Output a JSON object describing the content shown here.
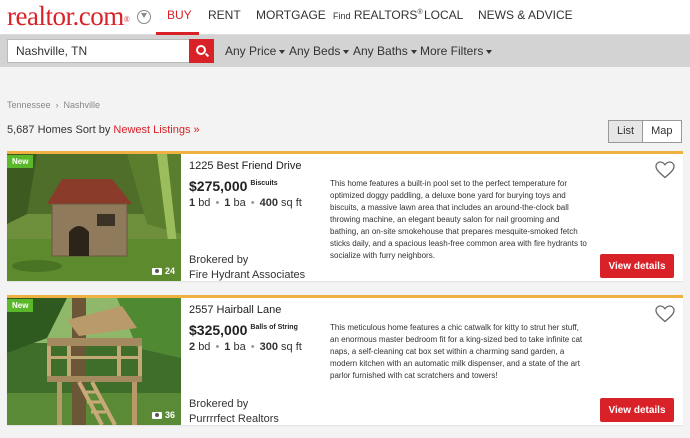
{
  "header": {
    "logo": "realtor.com",
    "logo_mark": "®",
    "nav": [
      {
        "label": "BUY",
        "active": true
      },
      {
        "label": "RENT"
      },
      {
        "label": "MORTGAGE"
      },
      {
        "label_small": "Find",
        "label": "REALTORS",
        "mark": "®"
      },
      {
        "label": "LOCAL"
      },
      {
        "label": "NEWS & ADVICE"
      }
    ]
  },
  "search": {
    "value": "Nashville, TN",
    "filters": [
      "Any Price",
      "Any Beds",
      "Any Baths",
      "More Filters"
    ]
  },
  "breadcrumb": [
    "Tennessee",
    "Nashville"
  ],
  "results": {
    "count_text": "5,687 Homes Sort by",
    "sort_label": "Newest Listings »"
  },
  "view_toggle": {
    "list": "List",
    "map": "Map"
  },
  "listings": [
    {
      "badge": "New",
      "photo_count": "24",
      "address": "1225 Best Friend Drive",
      "price": "$275,000",
      "price_brand": "Biscuits",
      "beds": "1",
      "beds_label": "bd",
      "baths": "1",
      "baths_label": "ba",
      "sqft": "400",
      "sqft_label": "sq ft",
      "broker_label": "Brokered by",
      "broker": "Fire Hydrant Associates",
      "description": "This home features a built-in pool set to the perfect temperature for optimized doggy paddling, a deluxe bone yard for burying toys and biscuits, a massive lawn area that includes an around-the-clock ball throwing machine, an elegant beauty salon for nail grooming and bathing, an on-site smokehouse that prepares mesquite-smoked fetch sticks daily, and a spacious leash-free common area with fire hydrants to socialize with furry neighbors.",
      "button": "View details"
    },
    {
      "badge": "New",
      "photo_count": "36",
      "address": "2557 Hairball Lane",
      "price": "$325,000",
      "price_brand": "Balls of String",
      "beds": "2",
      "beds_label": "bd",
      "baths": "1",
      "baths_label": "ba",
      "sqft": "300",
      "sqft_label": "sq ft",
      "broker_label": "Brokered by",
      "broker": "Purrrrfect Realtors",
      "description": "This meticulous home features a chic catwalk for kitty to strut her stuff, an enormous master bedroom fit for a king-sized bed to take infinite cat naps, a self-cleaning cat box set within a charming sand garden, a modern kitchen with an automatic milk dispenser, and a state of the art parlor furnished with cat scratchers and towers!",
      "button": "View details"
    }
  ],
  "colors": {
    "brand": "#d92228",
    "new_badge": "#5cb82b",
    "card_accent": "#f0b143"
  }
}
